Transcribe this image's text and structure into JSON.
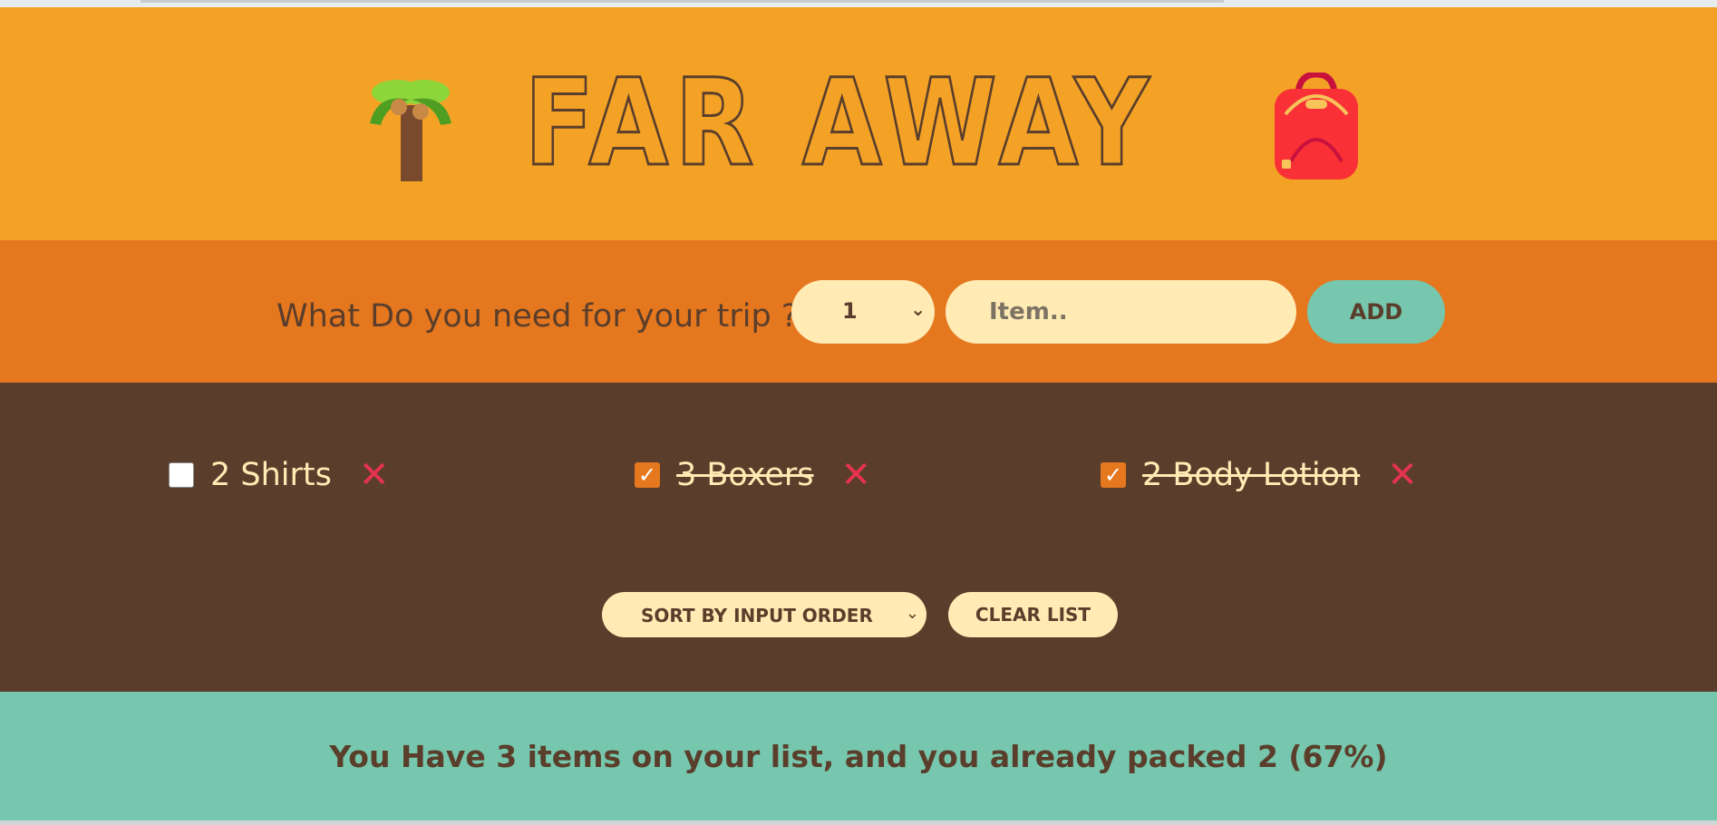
{
  "header": {
    "title": "FAR AWAY",
    "left_icon": "palm-tree-icon",
    "right_icon": "backpack-icon"
  },
  "form": {
    "question": "What Do you need for your trip ?",
    "quantity_value": "1",
    "item_placeholder": "Item..",
    "add_label": "ADD"
  },
  "list": {
    "items": [
      {
        "label": "2 Shirts",
        "packed": false
      },
      {
        "label": "3 Boxers",
        "packed": true
      },
      {
        "label": "2 Body Lotion",
        "packed": true
      }
    ],
    "delete_icon": "close-icon",
    "sort_value": "SORT BY INPUT ORDER",
    "clear_label": "CLEAR LIST"
  },
  "stats": {
    "text": "You Have 3 items on your list, and you already packed 2 (67%)"
  },
  "colors": {
    "header_bg": "#f4a226",
    "form_bg": "#e5771f",
    "list_bg": "#5a3e2b",
    "stats_bg": "#76c7ad",
    "cream": "#ffebb3",
    "delete_red": "#e5334f"
  }
}
